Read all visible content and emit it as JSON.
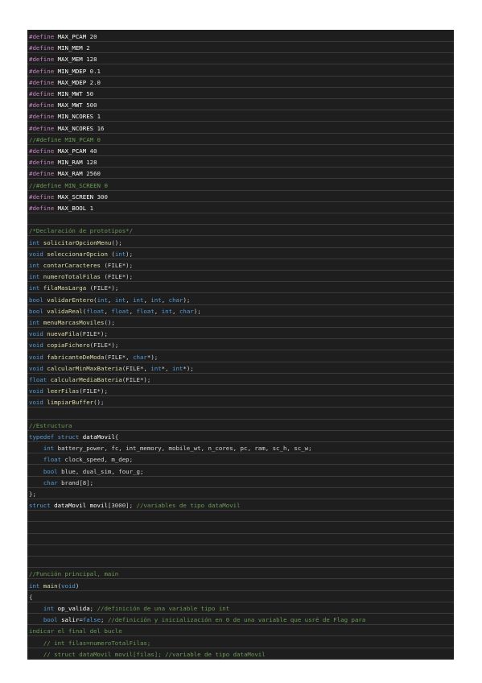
{
  "colors": {
    "background": "#1e1e1e",
    "preprocessor": "#c586c0",
    "keyword": "#569cd6",
    "function": "#dcdcaa",
    "comment": "#6a9955",
    "text": "#d4d4d4",
    "variable": "#9cdcfe"
  },
  "lines": [
    {
      "line_index": 0,
      "spans": [
        {
          "c": "pre",
          "t": "#define"
        },
        {
          "c": "id",
          "t": " MAX_PCAM "
        },
        {
          "c": "num",
          "t": "20"
        }
      ]
    },
    {
      "line_index": 1,
      "spans": [
        {
          "c": "pre",
          "t": "#define"
        },
        {
          "c": "id",
          "t": " MIN_MEM "
        },
        {
          "c": "num",
          "t": "2"
        }
      ]
    },
    {
      "line_index": 2,
      "spans": [
        {
          "c": "pre",
          "t": "#define"
        },
        {
          "c": "id",
          "t": " MAX_MEM "
        },
        {
          "c": "num",
          "t": "128"
        }
      ]
    },
    {
      "line_index": 3,
      "spans": [
        {
          "c": "pre",
          "t": "#define"
        },
        {
          "c": "id",
          "t": " MIN_MDEP "
        },
        {
          "c": "num",
          "t": "0.1"
        }
      ]
    },
    {
      "line_index": 4,
      "spans": [
        {
          "c": "pre",
          "t": "#define"
        },
        {
          "c": "id",
          "t": " MAX_MDEP "
        },
        {
          "c": "num",
          "t": "2.0"
        }
      ]
    },
    {
      "line_index": 5,
      "spans": [
        {
          "c": "pre",
          "t": "#define"
        },
        {
          "c": "id",
          "t": " MIN_MWT "
        },
        {
          "c": "num",
          "t": "50"
        }
      ]
    },
    {
      "line_index": 6,
      "spans": [
        {
          "c": "pre",
          "t": "#define"
        },
        {
          "c": "id",
          "t": " MAX_MWT "
        },
        {
          "c": "num",
          "t": "500"
        }
      ]
    },
    {
      "line_index": 7,
      "spans": [
        {
          "c": "pre",
          "t": "#define"
        },
        {
          "c": "id",
          "t": " MIN_NCORES "
        },
        {
          "c": "num",
          "t": "1"
        }
      ]
    },
    {
      "line_index": 8,
      "spans": [
        {
          "c": "pre",
          "t": "#define"
        },
        {
          "c": "id",
          "t": " MAX_NCORES "
        },
        {
          "c": "num",
          "t": "16"
        }
      ]
    },
    {
      "line_index": 9,
      "spans": [
        {
          "c": "cm",
          "t": "//#define MIN_PCAM 0"
        }
      ]
    },
    {
      "line_index": 10,
      "spans": [
        {
          "c": "pre",
          "t": "#define"
        },
        {
          "c": "id",
          "t": " MAX_PCAM "
        },
        {
          "c": "num",
          "t": "40"
        }
      ]
    },
    {
      "line_index": 11,
      "spans": [
        {
          "c": "pre",
          "t": "#define"
        },
        {
          "c": "id",
          "t": " MIN_RAM "
        },
        {
          "c": "num",
          "t": "128"
        }
      ]
    },
    {
      "line_index": 12,
      "spans": [
        {
          "c": "pre",
          "t": "#define"
        },
        {
          "c": "id",
          "t": " MAX_RAM "
        },
        {
          "c": "num",
          "t": "2560"
        }
      ]
    },
    {
      "line_index": 13,
      "spans": [
        {
          "c": "cm",
          "t": "//#define MIN_SCREEN 0"
        }
      ]
    },
    {
      "line_index": 14,
      "spans": [
        {
          "c": "pre",
          "t": "#define"
        },
        {
          "c": "id",
          "t": " MAX_SCREEN "
        },
        {
          "c": "num",
          "t": "300"
        }
      ]
    },
    {
      "line_index": 15,
      "spans": [
        {
          "c": "pre",
          "t": "#define"
        },
        {
          "c": "id",
          "t": " MAX_BOOL "
        },
        {
          "c": "num",
          "t": "1"
        }
      ]
    },
    {
      "line_index": 16,
      "spans": []
    },
    {
      "line_index": 17,
      "spans": [
        {
          "c": "cm",
          "t": "/*Declaración de prototipos*/"
        }
      ]
    },
    {
      "line_index": 18,
      "spans": [
        {
          "c": "kw",
          "t": "int"
        },
        {
          "c": "fn",
          "t": " solicitarOpcionMenu"
        },
        {
          "c": "tx",
          "t": "();"
        }
      ]
    },
    {
      "line_index": 19,
      "spans": [
        {
          "c": "kw",
          "t": "void"
        },
        {
          "c": "fn",
          "t": " seleccionarOpcion"
        },
        {
          "c": "tx",
          "t": " ("
        },
        {
          "c": "kw",
          "t": "int"
        },
        {
          "c": "tx",
          "t": ");"
        }
      ]
    },
    {
      "line_index": 20,
      "spans": [
        {
          "c": "kw",
          "t": "int"
        },
        {
          "c": "fn",
          "t": " contarCaracteres"
        },
        {
          "c": "tx",
          "t": " (FILE*);"
        }
      ]
    },
    {
      "line_index": 21,
      "spans": [
        {
          "c": "kw",
          "t": "int"
        },
        {
          "c": "fn",
          "t": " numeroTotalFilas"
        },
        {
          "c": "tx",
          "t": " (FILE*);"
        }
      ]
    },
    {
      "line_index": 22,
      "spans": [
        {
          "c": "kw",
          "t": "int"
        },
        {
          "c": "fn",
          "t": " filaMasLarga"
        },
        {
          "c": "tx",
          "t": " (FILE*);"
        }
      ]
    },
    {
      "line_index": 23,
      "spans": [
        {
          "c": "kw",
          "t": "bool"
        },
        {
          "c": "fn",
          "t": " validarEntero"
        },
        {
          "c": "tx",
          "t": "("
        },
        {
          "c": "kw",
          "t": "int"
        },
        {
          "c": "tx",
          "t": ", "
        },
        {
          "c": "kw",
          "t": "int"
        },
        {
          "c": "tx",
          "t": ", "
        },
        {
          "c": "kw",
          "t": "int"
        },
        {
          "c": "tx",
          "t": ", "
        },
        {
          "c": "kw",
          "t": "int"
        },
        {
          "c": "tx",
          "t": ", "
        },
        {
          "c": "kw",
          "t": "char"
        },
        {
          "c": "tx",
          "t": ");"
        }
      ]
    },
    {
      "line_index": 24,
      "spans": [
        {
          "c": "kw",
          "t": "bool"
        },
        {
          "c": "fn",
          "t": " validaReal"
        },
        {
          "c": "tx",
          "t": "("
        },
        {
          "c": "kw",
          "t": "float"
        },
        {
          "c": "tx",
          "t": ", "
        },
        {
          "c": "kw",
          "t": "float"
        },
        {
          "c": "tx",
          "t": ", "
        },
        {
          "c": "kw",
          "t": "float"
        },
        {
          "c": "tx",
          "t": ", "
        },
        {
          "c": "kw",
          "t": "int"
        },
        {
          "c": "tx",
          "t": ", "
        },
        {
          "c": "kw",
          "t": "char"
        },
        {
          "c": "tx",
          "t": ");"
        }
      ]
    },
    {
      "line_index": 25,
      "spans": [
        {
          "c": "kw",
          "t": "int"
        },
        {
          "c": "fn",
          "t": " menuMarcasMoviles"
        },
        {
          "c": "tx",
          "t": "();"
        }
      ]
    },
    {
      "line_index": 26,
      "spans": [
        {
          "c": "kw",
          "t": "void"
        },
        {
          "c": "fn",
          "t": " nuevaFila"
        },
        {
          "c": "tx",
          "t": "(FILE*);"
        }
      ]
    },
    {
      "line_index": 27,
      "spans": [
        {
          "c": "kw",
          "t": "void"
        },
        {
          "c": "fn",
          "t": " copiaFichero"
        },
        {
          "c": "tx",
          "t": "(FILE*);"
        }
      ]
    },
    {
      "line_index": 28,
      "spans": [
        {
          "c": "kw",
          "t": "void"
        },
        {
          "c": "fn",
          "t": " fabricanteDeModa"
        },
        {
          "c": "tx",
          "t": "(FILE*, "
        },
        {
          "c": "kw",
          "t": "char"
        },
        {
          "c": "tx",
          "t": "*);"
        }
      ]
    },
    {
      "line_index": 29,
      "spans": [
        {
          "c": "kw",
          "t": "void"
        },
        {
          "c": "fn",
          "t": " calcularMinMaxBateria"
        },
        {
          "c": "tx",
          "t": "(FILE*, "
        },
        {
          "c": "kw",
          "t": "int"
        },
        {
          "c": "tx",
          "t": "*, "
        },
        {
          "c": "kw",
          "t": "int"
        },
        {
          "c": "tx",
          "t": "*);"
        }
      ]
    },
    {
      "line_index": 30,
      "spans": [
        {
          "c": "kw",
          "t": "float"
        },
        {
          "c": "fn",
          "t": " calcularMediaBateria"
        },
        {
          "c": "tx",
          "t": "(FILE*);"
        }
      ]
    },
    {
      "line_index": 31,
      "spans": [
        {
          "c": "kw",
          "t": "void"
        },
        {
          "c": "fn",
          "t": " leerFilas"
        },
        {
          "c": "tx",
          "t": "(FILE*);"
        }
      ]
    },
    {
      "line_index": 32,
      "spans": [
        {
          "c": "kw",
          "t": "void"
        },
        {
          "c": "fn",
          "t": " limpiarBuffer"
        },
        {
          "c": "tx",
          "t": "();"
        }
      ]
    },
    {
      "line_index": 33,
      "spans": []
    },
    {
      "line_index": 34,
      "spans": [
        {
          "c": "cm",
          "t": "//Estructura"
        }
      ]
    },
    {
      "line_index": 35,
      "spans": [
        {
          "c": "kw",
          "t": "typedef struct"
        },
        {
          "c": "id",
          "t": " dataMovil"
        },
        {
          "c": "tx",
          "t": "{"
        }
      ]
    },
    {
      "line_index": 36,
      "spans": [
        {
          "c": "tx",
          "t": "    "
        },
        {
          "c": "kw",
          "t": "int"
        },
        {
          "c": "tx",
          "t": " battery_power, fc, int_memory, mobile_wt, n_cores, pc, ram, sc_h, sc_w;"
        }
      ]
    },
    {
      "line_index": 37,
      "spans": [
        {
          "c": "tx",
          "t": "    "
        },
        {
          "c": "kw",
          "t": "float"
        },
        {
          "c": "tx",
          "t": " clock_speed, m_dep;"
        }
      ]
    },
    {
      "line_index": 38,
      "spans": [
        {
          "c": "tx",
          "t": "    "
        },
        {
          "c": "kw",
          "t": "bool"
        },
        {
          "c": "tx",
          "t": " blue, dual_sim, four_g;"
        }
      ]
    },
    {
      "line_index": 39,
      "spans": [
        {
          "c": "tx",
          "t": "    "
        },
        {
          "c": "kw",
          "t": "char"
        },
        {
          "c": "tx",
          "t": " brand[8];"
        }
      ]
    },
    {
      "line_index": 40,
      "spans": [
        {
          "c": "tx",
          "t": "};"
        }
      ]
    },
    {
      "line_index": 41,
      "spans": [
        {
          "c": "kw",
          "t": "struct"
        },
        {
          "c": "id",
          "t": " dataMovil movil"
        },
        {
          "c": "tx",
          "t": "[3000]; "
        },
        {
          "c": "cm",
          "t": "//variables de tipo dataMovil"
        }
      ]
    },
    {
      "line_index": 42,
      "spans": []
    },
    {
      "line_index": 43,
      "spans": []
    },
    {
      "line_index": 44,
      "spans": []
    },
    {
      "line_index": 45,
      "spans": []
    },
    {
      "line_index": 46,
      "spans": []
    },
    {
      "line_index": 47,
      "spans": [
        {
          "c": "cm",
          "t": "//Función principal, main"
        }
      ]
    },
    {
      "line_index": 48,
      "spans": [
        {
          "c": "kw",
          "t": "int"
        },
        {
          "c": "fn",
          "t": " main"
        },
        {
          "c": "tx",
          "t": "("
        },
        {
          "c": "kw",
          "t": "void"
        },
        {
          "c": "tx",
          "t": ")"
        }
      ]
    },
    {
      "line_index": 49,
      "spans": [
        {
          "c": "tx",
          "t": "{"
        }
      ]
    },
    {
      "line_index": 50,
      "spans": [
        {
          "c": "tx",
          "t": "    "
        },
        {
          "c": "kw",
          "t": "int"
        },
        {
          "c": "id",
          "t": " op_valida"
        },
        {
          "c": "tx",
          "t": "; "
        },
        {
          "c": "cm",
          "t": "//definición de una variable tipo int"
        }
      ]
    },
    {
      "line_index": 51,
      "spans": [
        {
          "c": "tx",
          "t": "    "
        },
        {
          "c": "kw",
          "t": "bool"
        },
        {
          "c": "id",
          "t": " salir"
        },
        {
          "c": "tx",
          "t": "="
        },
        {
          "c": "kw",
          "t": "false"
        },
        {
          "c": "tx",
          "t": "; "
        },
        {
          "c": "cm",
          "t": "//definición y inicialización en 0 de una variable que usré de Flag para"
        }
      ]
    },
    {
      "line_index": 52,
      "spans": [
        {
          "c": "cm",
          "t": "indicar el final del bucle"
        }
      ]
    },
    {
      "line_index": 53,
      "spans": [
        {
          "c": "tx",
          "t": "    "
        },
        {
          "c": "cm",
          "t": "// int filas=numeroTotalFilas;"
        }
      ]
    },
    {
      "line_index": 54,
      "spans": [
        {
          "c": "tx",
          "t": "    "
        },
        {
          "c": "cm",
          "t": "// struct dataMovil movil[filas]; //variable de tipo dataMovil"
        }
      ]
    }
  ]
}
